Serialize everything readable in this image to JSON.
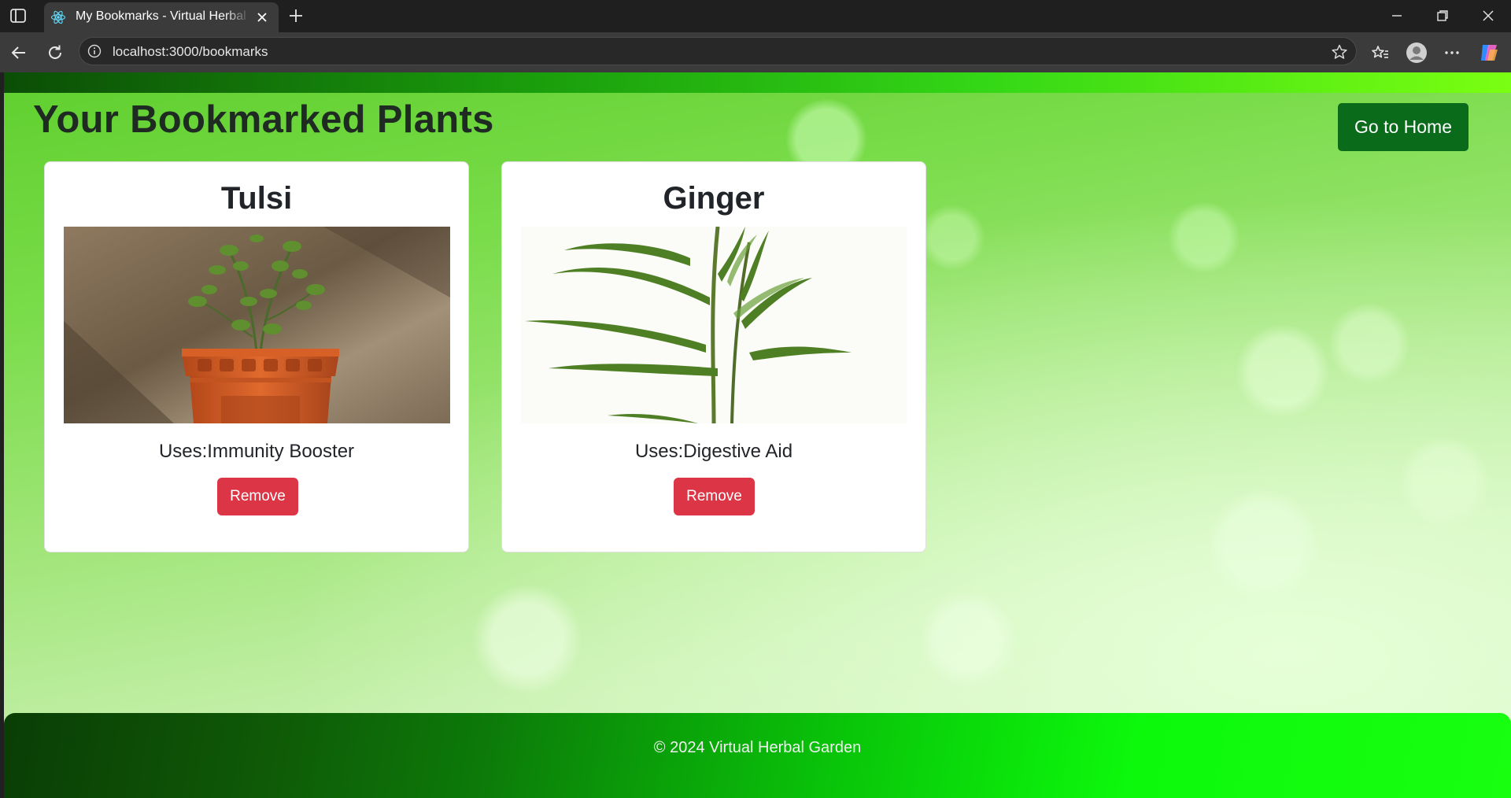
{
  "browser": {
    "tab_title": "My Bookmarks - Virtual Herbal Garden",
    "url": "localhost:3000/bookmarks"
  },
  "page": {
    "title": "Your Bookmarked Plants",
    "home_button_label": "Go to Home"
  },
  "bookmarks": [
    {
      "name": "Tulsi",
      "uses": "Uses:Immunity Booster",
      "remove_label": "Remove"
    },
    {
      "name": "Ginger",
      "uses": "Uses:Digestive Aid",
      "remove_label": "Remove"
    }
  ],
  "footer": {
    "text": "© 2024 Virtual Herbal Garden"
  },
  "colors": {
    "home_button": "#0a6b1b",
    "remove_button": "#dc3545",
    "header_strip_end": "#7aff12",
    "footer_end": "#18ff10"
  }
}
